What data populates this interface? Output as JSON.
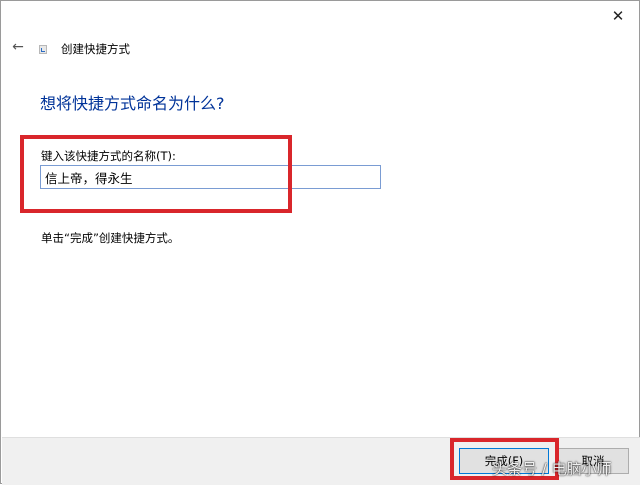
{
  "window": {
    "close_glyph": "✕",
    "back_glyph": "←",
    "title": "创建快捷方式"
  },
  "main": {
    "heading": "想将快捷方式命名为什么?",
    "name_label": "键入该快捷方式的名称(T):",
    "name_value": "信上帝，得永生",
    "hint": "单击“完成”创建快捷方式。"
  },
  "footer": {
    "finish_label": "完成(F)",
    "cancel_label": "取消"
  },
  "watermark": {
    "text": "头条号 / 电脑小师"
  },
  "colors": {
    "heading": "#003399",
    "highlight": "#d9262b",
    "input_border": "#7a9cd3",
    "footer_bg": "#f0f0f0"
  },
  "icons": {
    "back": "back-arrow-icon",
    "close": "close-icon",
    "app": "shortcut-file-icon"
  }
}
